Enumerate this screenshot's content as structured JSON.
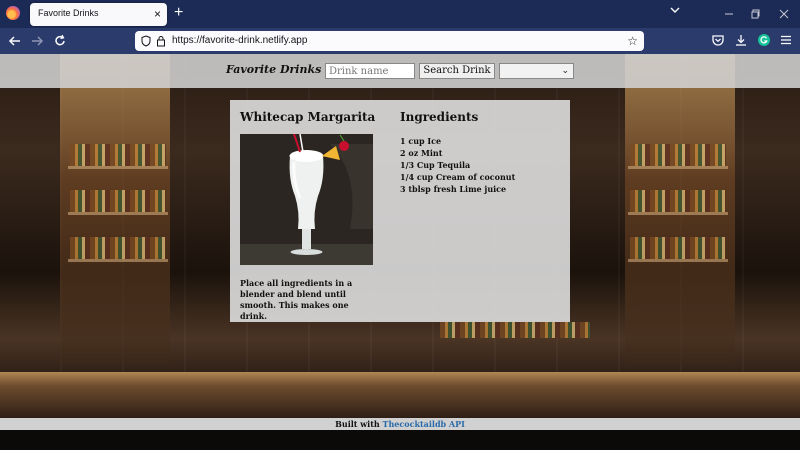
{
  "browser": {
    "tab_title": "Favorite Drinks",
    "tab_close": "×",
    "new_tab": "+",
    "url": "https://favorite-drink.netlify.app",
    "icons": [
      "firefox-logo-icon",
      "back-icon",
      "forward-icon",
      "reload-icon",
      "shield-icon",
      "lock-icon",
      "bookmark-star-icon",
      "pocket-icon",
      "download-icon",
      "grammarly-icon",
      "menu-icon",
      "tab-list-icon",
      "minimize-icon",
      "maximize-icon",
      "close-window-icon"
    ]
  },
  "site": {
    "title": "Favorite Drinks",
    "search_placeholder": "Drink name",
    "search_button": "Search Drink",
    "select_value": ""
  },
  "drink": {
    "name": "Whitecap Margarita",
    "ingredients_title": "Ingredients",
    "ingredients": [
      "1 cup Ice",
      "2 oz Mint",
      "1/3 Cup Tequila",
      "1/4 cup Cream of coconut",
      "3 tblsp fresh Lime juice"
    ],
    "instructions": "Place all ingredients in a blender and blend until smooth. This makes one drink."
  },
  "footer": {
    "prefix": "Built with",
    "link_text": "Thecocktaildb API",
    "link_color": "#2a6aa8"
  }
}
